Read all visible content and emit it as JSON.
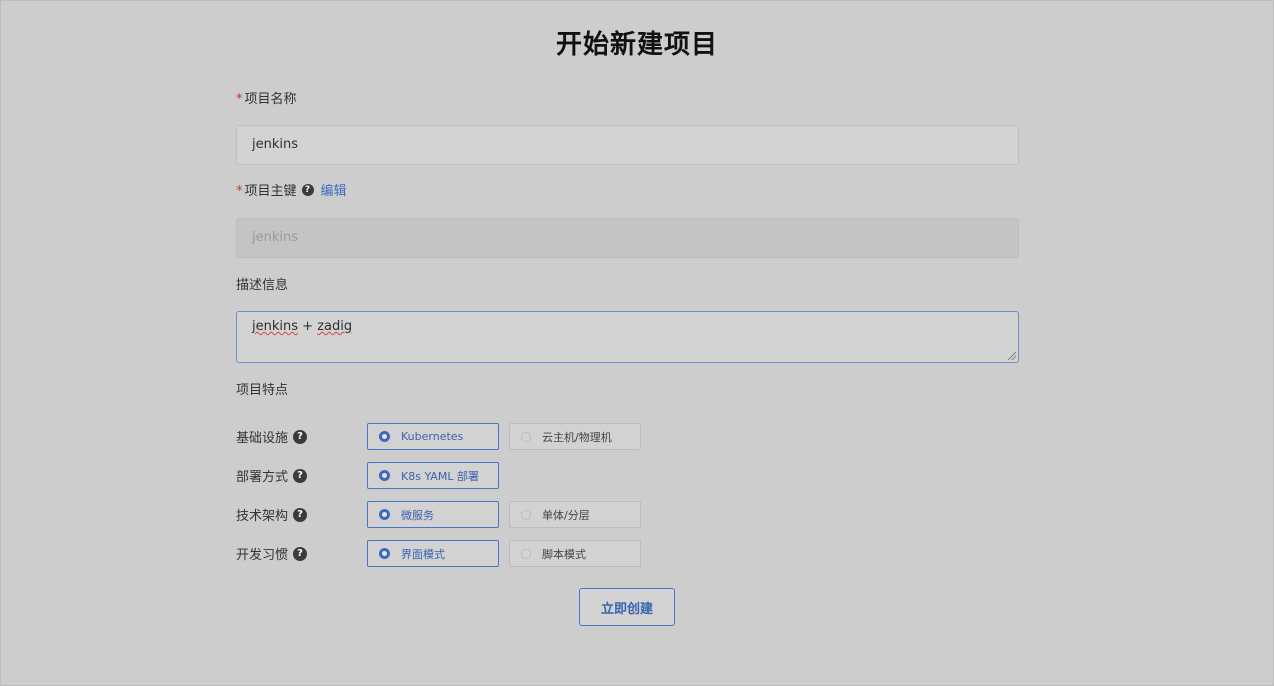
{
  "page": {
    "title": "开始新建项目"
  },
  "form": {
    "name": {
      "required_mark": "*",
      "label": "项目名称",
      "value": "jenkins"
    },
    "key": {
      "required_mark": "*",
      "label": "项目主键",
      "help_icon": "?",
      "edit_link": "编辑",
      "value": "jenkins"
    },
    "description": {
      "label": "描述信息",
      "value_word1": "jenkins",
      "value_rest": " + ",
      "value_word2": "zadig"
    },
    "features": {
      "label": "项目特点"
    },
    "infrastructure": {
      "label": "基础设施",
      "help_icon": "?",
      "options": [
        "Kubernetes",
        "云主机/物理机"
      ],
      "selected": "Kubernetes"
    },
    "deploy": {
      "label": "部署方式",
      "help_icon": "?",
      "options": [
        "K8s YAML 部署"
      ],
      "selected": "K8s YAML 部署"
    },
    "architecture": {
      "label": "技术架构",
      "help_icon": "?",
      "options": [
        "微服务",
        "单体/分层"
      ],
      "selected": "微服务"
    },
    "dev_habit": {
      "label": "开发习惯",
      "help_icon": "?",
      "options": [
        "界面模式",
        "脚本模式"
      ],
      "selected": "界面模式"
    },
    "submit_label": "立即创建"
  },
  "colors": {
    "accent": "#3a62b0",
    "required": "#c0392b",
    "background": "#cdcdcd"
  },
  "icons": {
    "help": "question-circle-icon",
    "radio_on": "radio-checked-icon",
    "radio_off": "radio-unchecked-icon"
  }
}
